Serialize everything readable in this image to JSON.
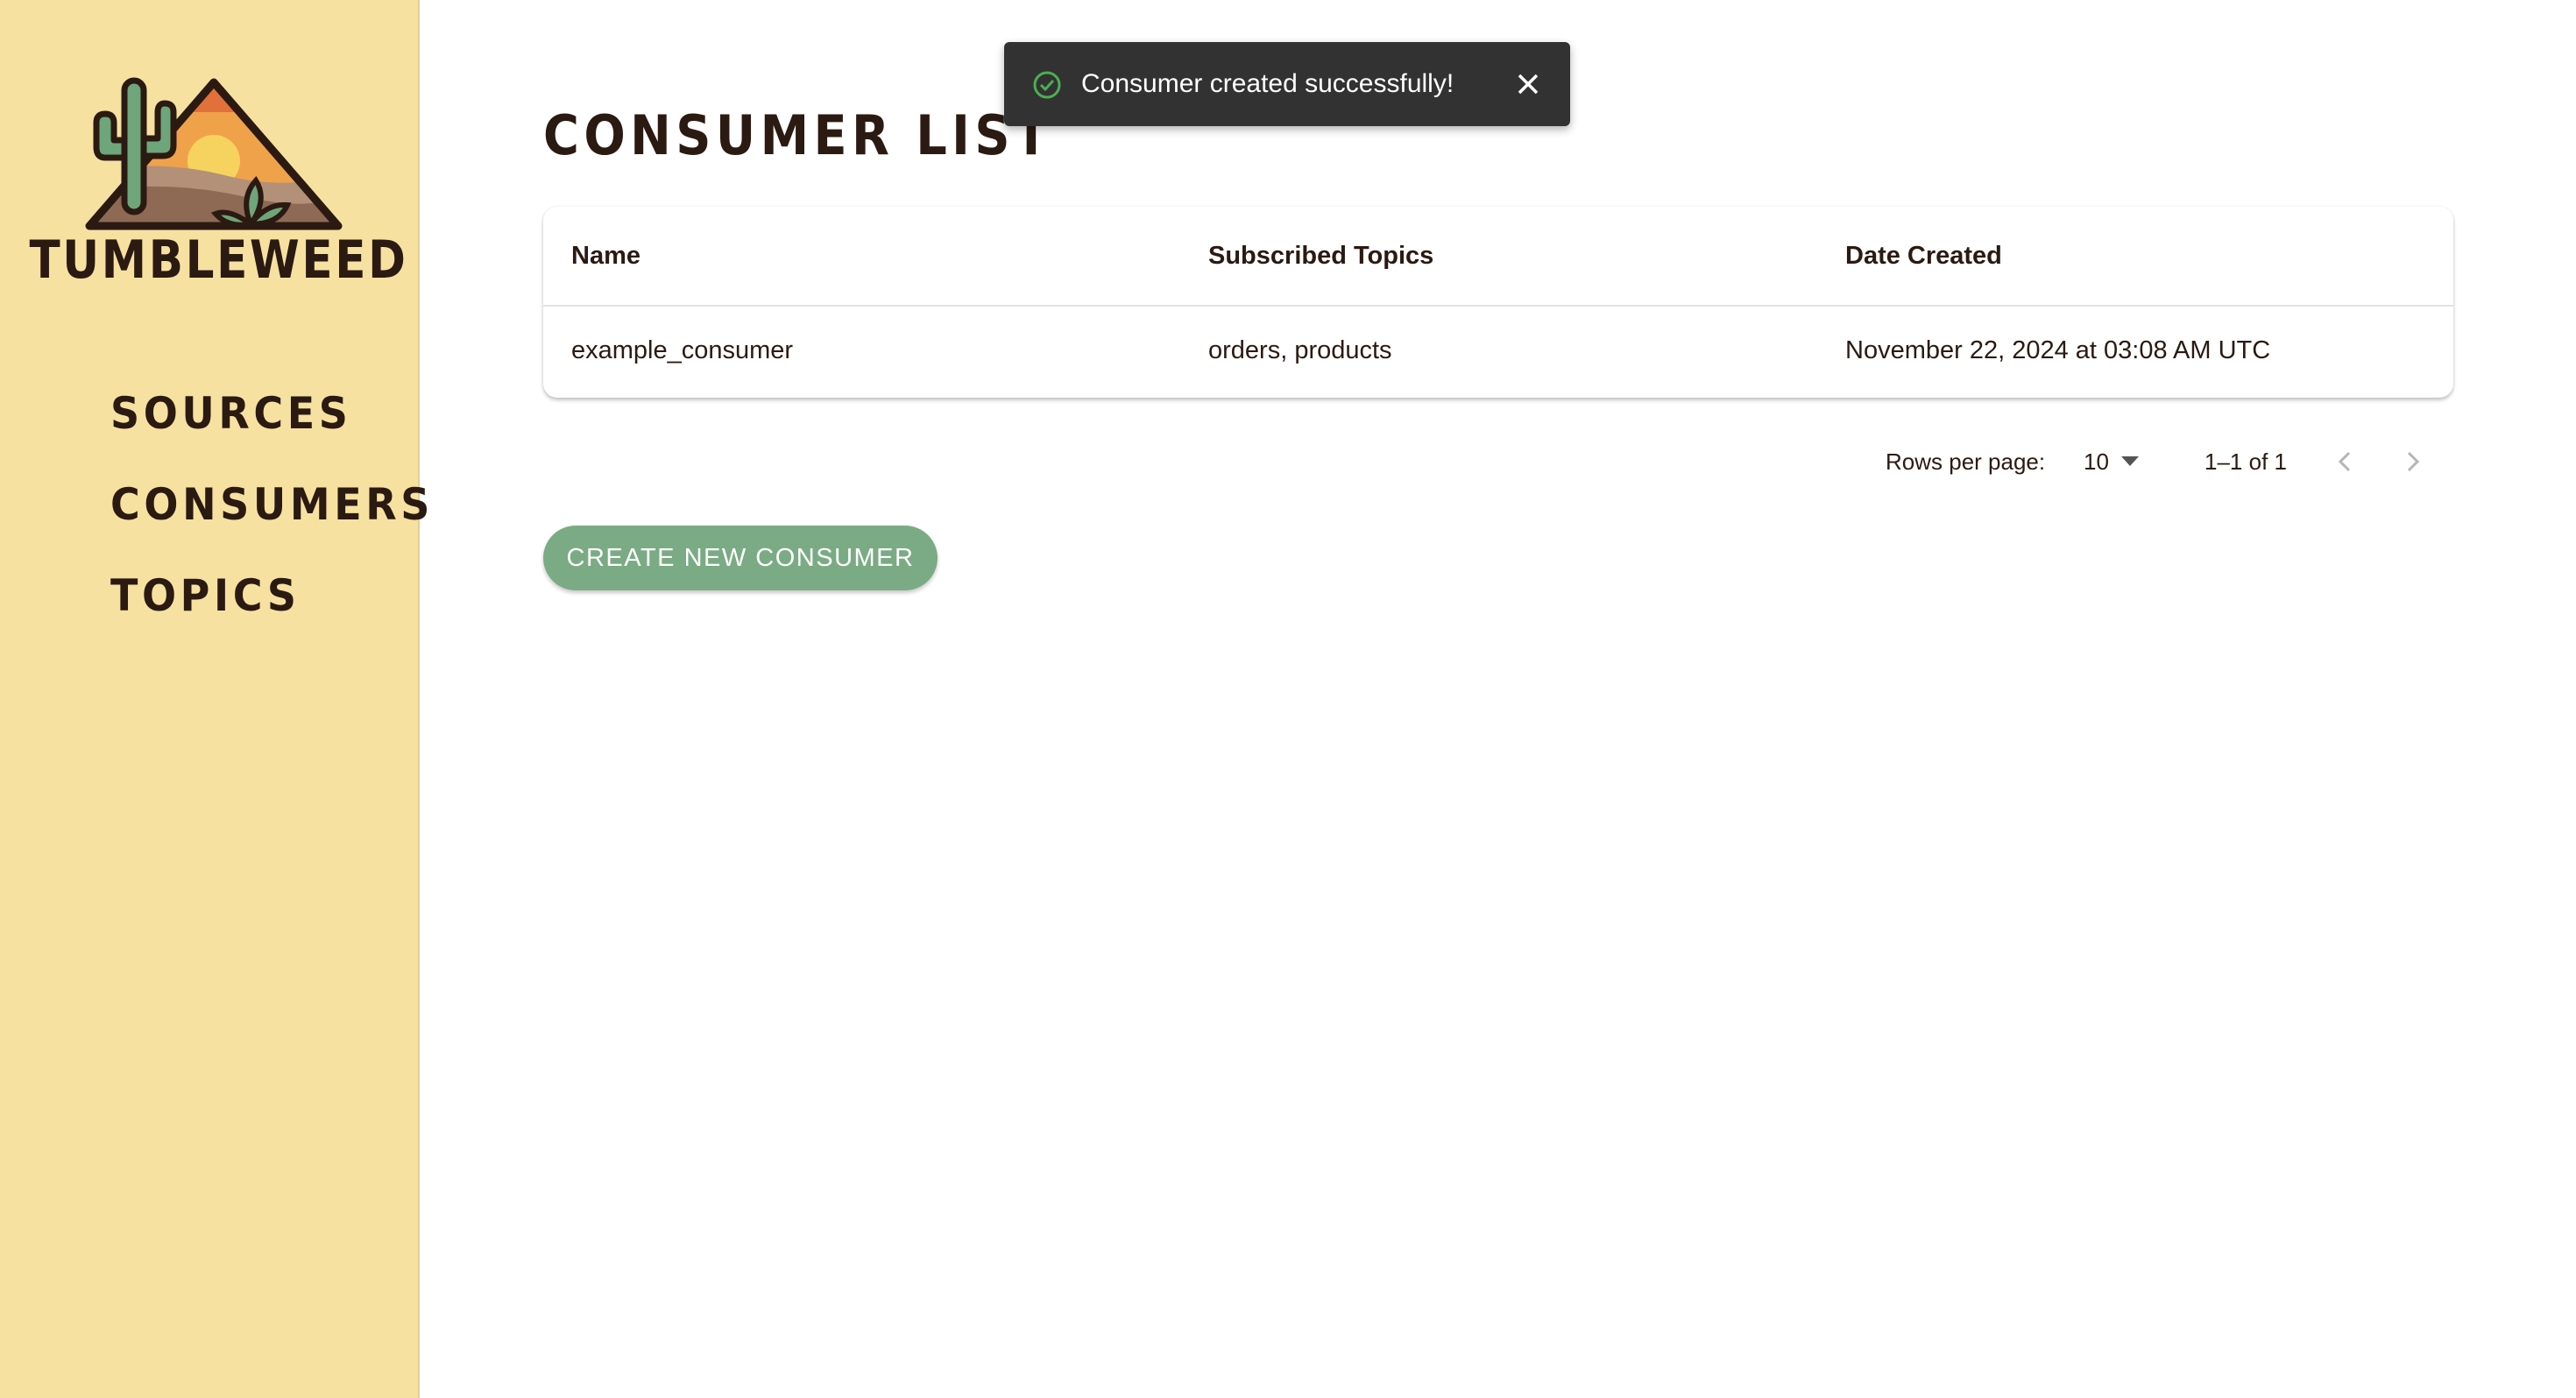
{
  "sidebar": {
    "brand": "TUMBLEWEED",
    "logo_icon": "desert-sunset-cactus-logo",
    "items": [
      {
        "label": "SOURCES"
      },
      {
        "label": "CONSUMERS"
      },
      {
        "label": "TOPICS"
      }
    ]
  },
  "main": {
    "title": "CONSUMER LIST",
    "table": {
      "headers": [
        "Name",
        "Subscribed Topics",
        "Date Created"
      ],
      "rows": [
        [
          "example_consumer",
          "orders, products",
          "November 22, 2024 at 03:08 AM UTC"
        ]
      ]
    },
    "pagination": {
      "rows_per_page_label": "Rows per page:",
      "rows_per_page_value": "10",
      "range": "1–1 of 1",
      "prev_icon": "chevron-left-icon",
      "next_icon": "chevron-right-icon"
    },
    "create_button_label": "CREATE NEW CONSUMER"
  },
  "toast": {
    "message": "Consumer created successfully!",
    "icon": "check-circle-icon",
    "close_icon": "close-icon"
  },
  "colors": {
    "sidebar_bg": "#f7e1a1",
    "text_dark": "#2b1a12",
    "button_green": "#7aab84",
    "toast_bg": "#323232",
    "success_green": "#4caf50"
  }
}
